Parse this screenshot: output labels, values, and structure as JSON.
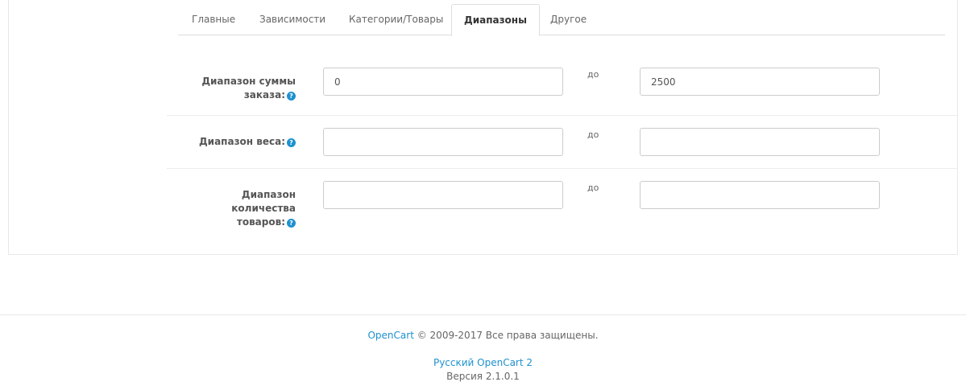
{
  "tabs": [
    {
      "label": "Главные",
      "active": false
    },
    {
      "label": "Зависимости",
      "active": false
    },
    {
      "label": "Категории/Товары",
      "active": false
    },
    {
      "label": "Диапазоны",
      "active": true
    },
    {
      "label": "Другое",
      "active": false
    }
  ],
  "form": {
    "help_glyph": "?",
    "to_label": "до",
    "rows": [
      {
        "label_lines": [
          "Диапазон суммы",
          "заказа:"
        ],
        "from_value": "0",
        "to_value": "2500"
      },
      {
        "label_lines": [
          "Диапазон веса:"
        ],
        "from_value": "",
        "to_value": ""
      },
      {
        "label_lines": [
          "Диапазон",
          "количества",
          "товаров:"
        ],
        "from_value": "",
        "to_value": ""
      }
    ]
  },
  "footer": {
    "brand_link": "OpenCart",
    "copyright": "© 2009-2017 Все права защищены.",
    "localization_link": "Русский OpenCart 2",
    "version": "Версия 2.1.0.1"
  },
  "colors": {
    "link": "#1e91cf",
    "help_badge": "#1e91cf",
    "border": "#cccccc"
  }
}
